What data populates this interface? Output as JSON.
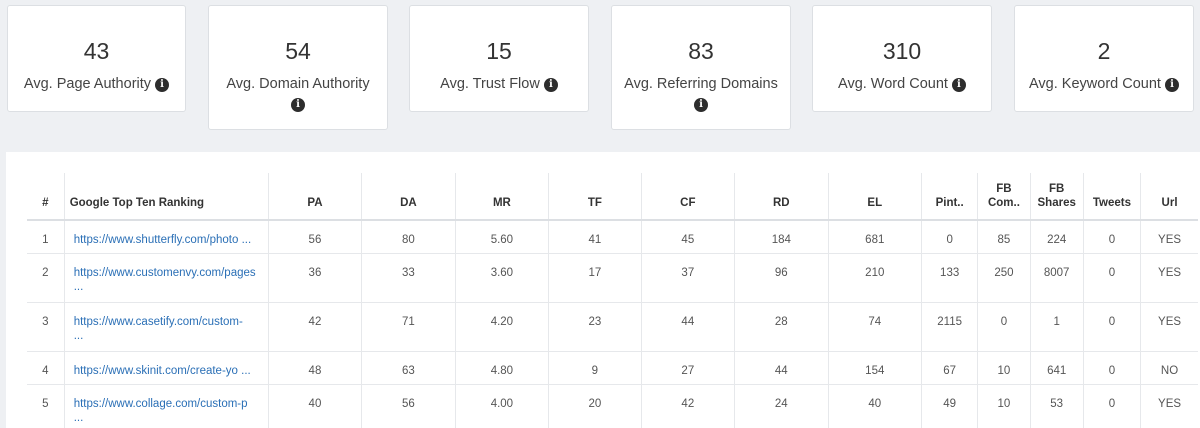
{
  "stats": [
    {
      "value": "43",
      "label": "Avg. Page Authority"
    },
    {
      "value": "54",
      "label": "Avg. Domain Authority"
    },
    {
      "value": "15",
      "label": "Avg. Trust Flow"
    },
    {
      "value": "83",
      "label": "Avg. Referring Domains"
    },
    {
      "value": "310",
      "label": "Avg. Word Count"
    },
    {
      "value": "2",
      "label": "Avg. Keyword Count"
    }
  ],
  "info_icon_glyph": "i",
  "table": {
    "headers": {
      "num": "#",
      "ranking": "Google Top Ten Ranking",
      "pa": "PA",
      "da": "DA",
      "mr": "MR",
      "tf": "TF",
      "cf": "CF",
      "rd": "RD",
      "el": "EL",
      "pint": "Pint..",
      "fb_com_1": "FB",
      "fb_com_2": "Com..",
      "fb_shares_1": "FB",
      "fb_shares_2": "Shares",
      "tweets": "Tweets",
      "url": "Url"
    },
    "rows": [
      {
        "num": "1",
        "url": "https://www.shutterfly.com/photo ...",
        "pa": "56",
        "da": "80",
        "mr": "5.60",
        "tf": "41",
        "cf": "45",
        "rd": "184",
        "el": "681",
        "pint": "0",
        "fb_com": "85",
        "fb_shares": "224",
        "tweets": "0",
        "url_flag": "YES"
      },
      {
        "num": "2",
        "url": "https://www.customenvy.com/pages\n...",
        "pa": "36",
        "da": "33",
        "mr": "3.60",
        "tf": "17",
        "cf": "37",
        "rd": "96",
        "el": "210",
        "pint": "133",
        "fb_com": "250",
        "fb_shares": "8007",
        "tweets": "0",
        "url_flag": "YES"
      },
      {
        "num": "3",
        "url": "https://www.casetify.com/custom-\n...",
        "pa": "42",
        "da": "71",
        "mr": "4.20",
        "tf": "23",
        "cf": "44",
        "rd": "28",
        "el": "74",
        "pint": "2115",
        "fb_com": "0",
        "fb_shares": "1",
        "tweets": "0",
        "url_flag": "YES"
      },
      {
        "num": "4",
        "url": "https://www.skinit.com/create-yo ...",
        "pa": "48",
        "da": "63",
        "mr": "4.80",
        "tf": "9",
        "cf": "27",
        "rd": "44",
        "el": "154",
        "pint": "67",
        "fb_com": "10",
        "fb_shares": "641",
        "tweets": "0",
        "url_flag": "NO"
      },
      {
        "num": "5",
        "url": "https://www.collage.com/custom-p\n...",
        "pa": "40",
        "da": "56",
        "mr": "4.00",
        "tf": "20",
        "cf": "42",
        "rd": "24",
        "el": "40",
        "pint": "49",
        "fb_com": "10",
        "fb_shares": "53",
        "tweets": "0",
        "url_flag": "YES"
      }
    ]
  }
}
